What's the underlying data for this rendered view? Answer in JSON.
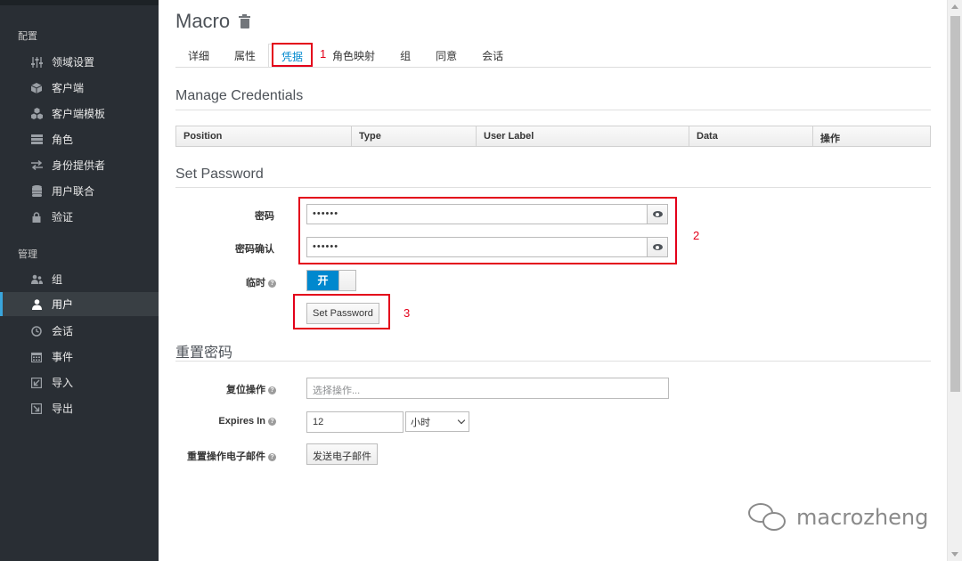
{
  "sidebar": {
    "section_config": "配置",
    "config_items": [
      {
        "label": "领域设置",
        "icon": "sliders-icon"
      },
      {
        "label": "客户端",
        "icon": "cube-icon"
      },
      {
        "label": "客户端模板",
        "icon": "cubes-icon"
      },
      {
        "label": "角色",
        "icon": "list-icon"
      },
      {
        "label": "身份提供者",
        "icon": "exchange-icon"
      },
      {
        "label": "用户联合",
        "icon": "database-icon"
      },
      {
        "label": "验证",
        "icon": "lock-icon"
      }
    ],
    "section_manage": "管理",
    "manage_items": [
      {
        "label": "组",
        "icon": "users-icon"
      },
      {
        "label": "用户",
        "icon": "user-icon",
        "active": true
      },
      {
        "label": "会话",
        "icon": "clock-icon"
      },
      {
        "label": "事件",
        "icon": "calendar-icon"
      },
      {
        "label": "导入",
        "icon": "import-icon"
      },
      {
        "label": "导出",
        "icon": "export-icon"
      }
    ]
  },
  "header": {
    "title": "Macro"
  },
  "tabs": [
    "详细",
    "属性",
    "凭据",
    "角色映射",
    "组",
    "同意",
    "会话"
  ],
  "active_tab": "凭据",
  "annotations": {
    "n1": "1",
    "n2": "2",
    "n3": "3"
  },
  "credentials": {
    "heading": "Manage Credentials",
    "columns": [
      "Position",
      "Type",
      "User Label",
      "Data",
      "操作"
    ]
  },
  "set_password": {
    "heading": "Set Password",
    "password_label": "密码",
    "password_value": "••••••",
    "confirm_label": "密码确认",
    "confirm_value": "••••••",
    "temporary_label": "临时",
    "temporary_toggle": "开",
    "button": "Set Password"
  },
  "reset_password": {
    "heading": "重置密码",
    "actions_label": "复位操作",
    "actions_placeholder": "选择操作...",
    "expires_label": "Expires In",
    "expires_value": "12",
    "expires_unit": "小时",
    "email_label": "重置操作电子邮件",
    "email_button": "发送电子邮件"
  },
  "watermark": "macrozheng",
  "colors": {
    "accent": "#0088ce",
    "sidebar_bg": "#292e34",
    "annotation": "#e3001a"
  }
}
